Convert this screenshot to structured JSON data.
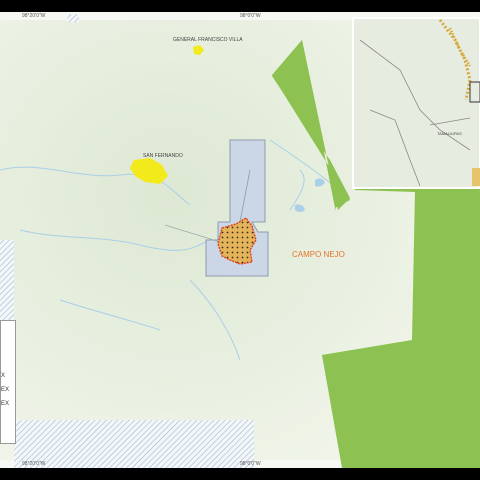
{
  "coordinates": {
    "top_left": "98°20'0\"W",
    "top_center": "98°0'0\"W",
    "bottom_left": "98°20'0\"W",
    "bottom_center": "98°0'0\"W"
  },
  "places": {
    "general_francisco_villa": "GENERAL FRANCISCO VILLA",
    "san_fernando": "SAN FERNANDO",
    "campo_nejo": "CAMPO NEJO",
    "tamaulipas": "TAMAULIPAS"
  },
  "legend": {
    "entries": [
      "X",
      "EX",
      "EX"
    ]
  },
  "colors": {
    "base_map": "#eaf0e1",
    "green_area": "#8dc152",
    "block_fill": "#cbd6e6",
    "block_stroke": "#8d9bb0",
    "field_fill": "#e4b45a",
    "field_stroke": "#e0401a",
    "town_fill": "#f3ea1c",
    "campo_label": "#e8742a",
    "river": "#a9cfe9",
    "hatch": "#9fb8d0"
  }
}
